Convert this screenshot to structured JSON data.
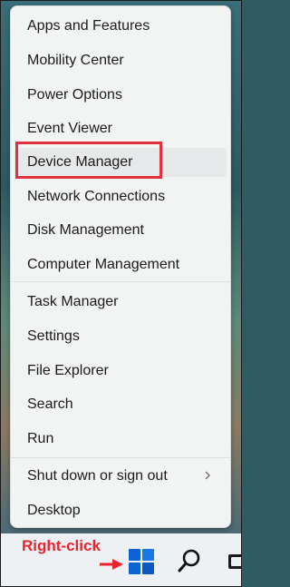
{
  "menu": {
    "items": [
      {
        "label": "Apps and Features"
      },
      {
        "label": "Mobility Center"
      },
      {
        "label": "Power Options"
      },
      {
        "label": "Event Viewer"
      },
      {
        "label": "Device Manager"
      },
      {
        "label": "Network Connections"
      },
      {
        "label": "Disk Management"
      },
      {
        "label": "Computer Management"
      },
      {
        "label": "Task Manager"
      },
      {
        "label": "Settings"
      },
      {
        "label": "File Explorer"
      },
      {
        "label": "Search"
      },
      {
        "label": "Run"
      },
      {
        "label": "Shut down or sign out"
      },
      {
        "label": "Desktop"
      }
    ]
  },
  "annotation": {
    "text": "Right-click",
    "color": "#e8242f"
  },
  "taskbar": {
    "icons": [
      "windows-start-icon",
      "search-icon",
      "task-view-icon"
    ],
    "accent": "#0a5fd1"
  }
}
